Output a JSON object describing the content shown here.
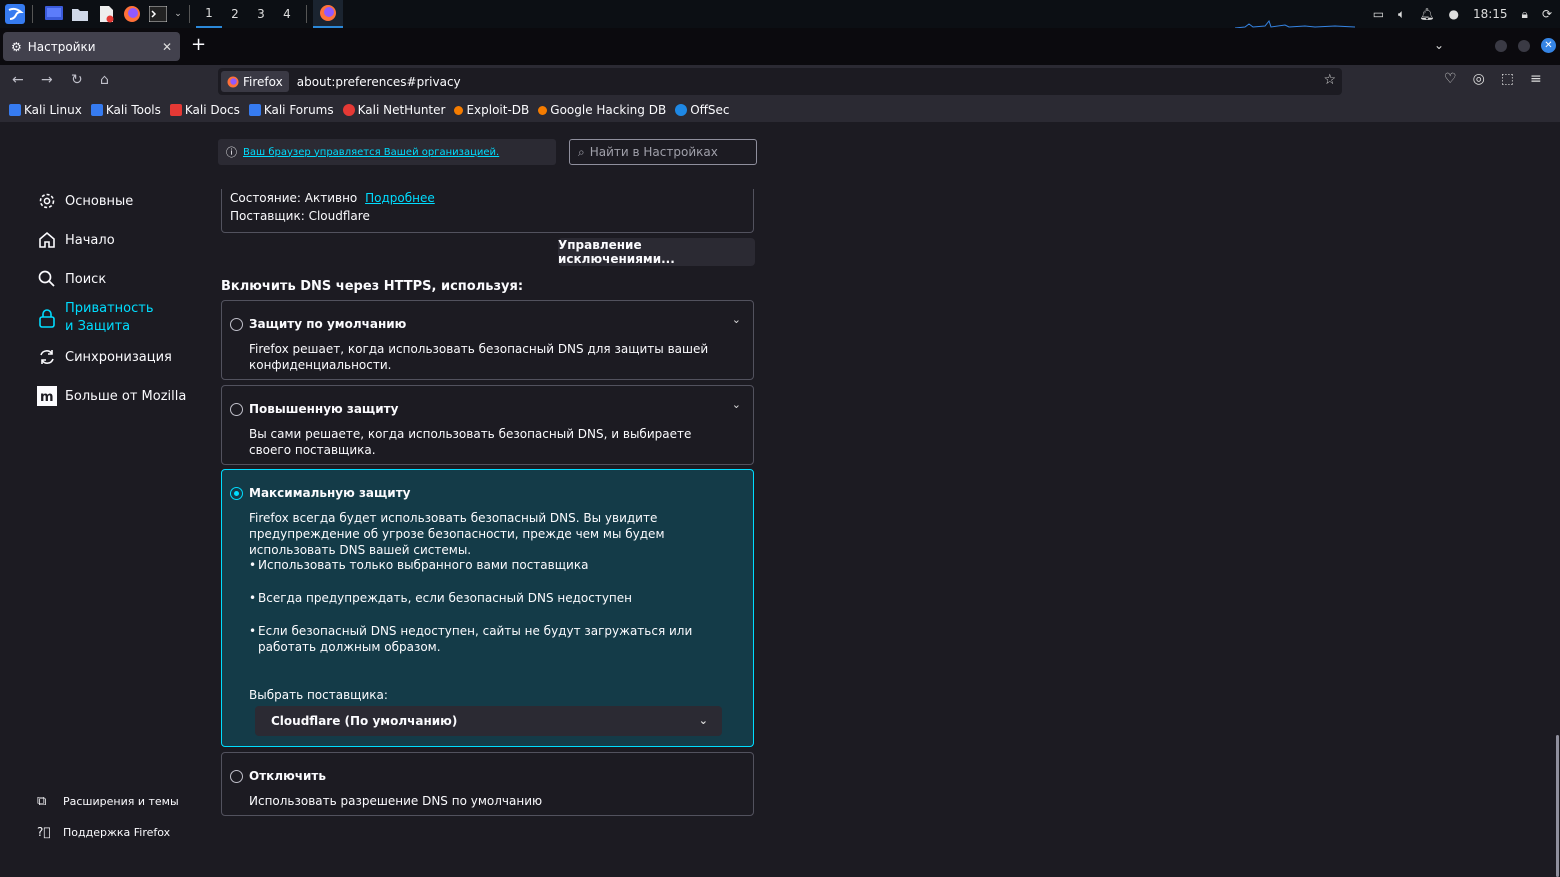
{
  "taskbar": {
    "workspaces": [
      "1",
      "2",
      "3",
      "4"
    ],
    "clock": "18:15"
  },
  "tab": {
    "title": "Настройки"
  },
  "urlbar": {
    "identity": "Firefox",
    "url": "about:preferences#privacy"
  },
  "bookmarks": [
    {
      "label": "Kali Linux",
      "color": "#367bf0"
    },
    {
      "label": "Kali Tools",
      "color": "#367bf0"
    },
    {
      "label": "Kali Docs",
      "color": "#e53935"
    },
    {
      "label": "Kali Forums",
      "color": "#367bf0"
    },
    {
      "label": "Kali NetHunter",
      "color": "#e53935"
    },
    {
      "label": "Exploit-DB",
      "color": "#f57c00"
    },
    {
      "label": "Google Hacking DB",
      "color": "#f57c00"
    },
    {
      "label": "OffSec",
      "color": "#1e88e5"
    }
  ],
  "policy": {
    "text": "Ваш браузер управляется Вашей организацией."
  },
  "search": {
    "placeholder": "Найти в Настройках"
  },
  "sidebar": {
    "items": [
      {
        "label": "Основные",
        "icon": "gear-icon"
      },
      {
        "label": "Начало",
        "icon": "home-icon"
      },
      {
        "label": "Поиск",
        "icon": "search-icon"
      },
      {
        "label": "Приватность и Защита",
        "icon": "lock-icon"
      },
      {
        "label": "Синхронизация",
        "icon": "sync-icon"
      },
      {
        "label": "Больше от Mozilla",
        "icon": "mozilla-icon"
      }
    ],
    "footer": [
      {
        "label": "Расширения и темы",
        "icon": "puzzle-icon"
      },
      {
        "label": "Поддержка Firefox",
        "icon": "help-icon"
      }
    ]
  },
  "status": {
    "state_label": "Состояние: Активно",
    "more_link": "Подробнее",
    "provider": "Поставщик: Cloudflare"
  },
  "manage_exceptions": "Управление исключениями...",
  "dns": {
    "heading": "Включить DNS через HTTPS, используя:",
    "options": [
      {
        "title": "Защиту по умолчанию",
        "desc": "Firefox решает, когда использовать безопасный DNS для защиты вашей конфиденциальности.",
        "selected": false
      },
      {
        "title": "Повышенную защиту",
        "desc": "Вы сами решаете, когда использовать безопасный DNS, и выбираете своего поставщика.",
        "selected": false
      },
      {
        "title": "Максимальную защиту",
        "desc": "Firefox всегда будет использовать безопасный DNS. Вы увидите предупреждение об угрозе безопасности, прежде чем мы будем использовать DNS вашей системы.",
        "selected": true,
        "bullets": [
          "Использовать только выбранного вами поставщика",
          "Всегда предупреждать, если безопасный DNS недоступен",
          "Если безопасный DNS недоступен, сайты не будут загружаться или работать должным образом."
        ],
        "provider_label": "Выбрать поставщика:",
        "provider_value": "Cloudflare (По умолчанию)"
      },
      {
        "title": "Отключить",
        "desc": "Использовать разрешение DNS по умолчанию",
        "selected": false
      }
    ]
  },
  "colors": {
    "accent": "#00ddff",
    "background": "#1c1b22",
    "selected_bg": "#143b48"
  }
}
